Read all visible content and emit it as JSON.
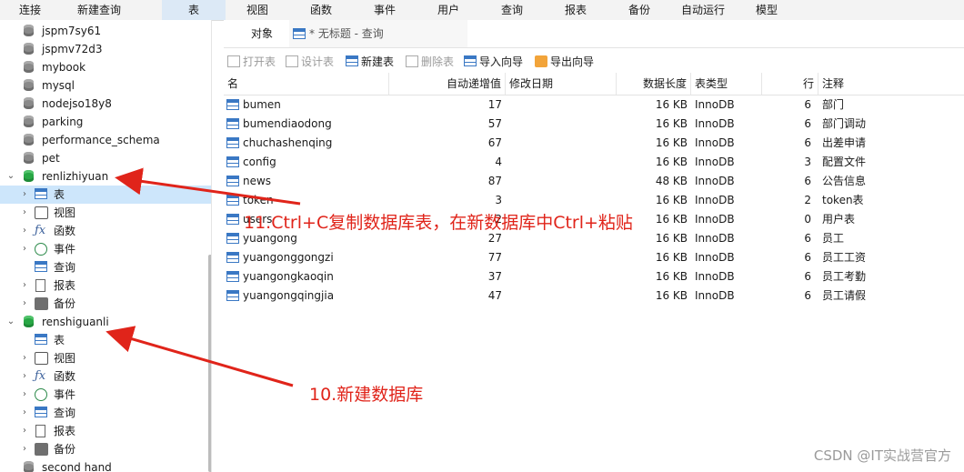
{
  "menubar": {
    "items": [
      "连接",
      "新建查询",
      "表",
      "视图",
      "函数",
      "事件",
      "用户",
      "查询",
      "报表",
      "备份",
      "自动运行",
      "模型"
    ],
    "active_index": 2
  },
  "sidebar": {
    "rows": [
      {
        "label": "jspm7sy61"
      },
      {
        "label": "jspmv72d3"
      },
      {
        "label": "mybook"
      },
      {
        "label": "mysql"
      },
      {
        "label": "nodejso18y8"
      },
      {
        "label": "parking"
      },
      {
        "label": "performance_schema"
      },
      {
        "label": "pet"
      },
      {
        "label": "renlizhiyuan"
      },
      {
        "label": "表"
      },
      {
        "label": "视图"
      },
      {
        "label": "函数"
      },
      {
        "label": "事件"
      },
      {
        "label": "查询"
      },
      {
        "label": "报表"
      },
      {
        "label": "备份"
      },
      {
        "label": "renshiguanli"
      },
      {
        "label": "表"
      },
      {
        "label": "视图"
      },
      {
        "label": "函数"
      },
      {
        "label": "事件"
      },
      {
        "label": "查询"
      },
      {
        "label": "报表"
      },
      {
        "label": "备份"
      },
      {
        "label": "second hand"
      }
    ]
  },
  "tabs": {
    "objects": "对象",
    "query": "* 无标题 - 查询"
  },
  "toolbar": {
    "open": "打开表",
    "design": "设计表",
    "new": "新建表",
    "delete": "删除表",
    "import": "导入向导",
    "export": "导出向导"
  },
  "table": {
    "headers": {
      "name": "名",
      "auto_inc": "自动递增值",
      "modified": "修改日期",
      "data_len": "数据长度",
      "engine": "表类型",
      "rows": "行",
      "comment": "注释"
    },
    "rows": [
      {
        "name": "bumen",
        "auto_inc": "17",
        "modified": "",
        "data_len": "16 KB",
        "engine": "InnoDB",
        "rows": "6",
        "comment": "部门"
      },
      {
        "name": "bumendiaodong",
        "auto_inc": "57",
        "modified": "",
        "data_len": "16 KB",
        "engine": "InnoDB",
        "rows": "6",
        "comment": "部门调动"
      },
      {
        "name": "chuchashenqing",
        "auto_inc": "67",
        "modified": "",
        "data_len": "16 KB",
        "engine": "InnoDB",
        "rows": "6",
        "comment": "出差申请"
      },
      {
        "name": "config",
        "auto_inc": "4",
        "modified": "",
        "data_len": "16 KB",
        "engine": "InnoDB",
        "rows": "3",
        "comment": "配置文件"
      },
      {
        "name": "news",
        "auto_inc": "87",
        "modified": "",
        "data_len": "48 KB",
        "engine": "InnoDB",
        "rows": "6",
        "comment": "公告信息"
      },
      {
        "name": "token",
        "auto_inc": "3",
        "modified": "",
        "data_len": "16 KB",
        "engine": "InnoDB",
        "rows": "2",
        "comment": "token表"
      },
      {
        "name": "users",
        "auto_inc": "2",
        "modified": "",
        "data_len": "16 KB",
        "engine": "InnoDB",
        "rows": "0",
        "comment": "用户表"
      },
      {
        "name": "yuangong",
        "auto_inc": "27",
        "modified": "",
        "data_len": "16 KB",
        "engine": "InnoDB",
        "rows": "6",
        "comment": "员工"
      },
      {
        "name": "yuangonggongzi",
        "auto_inc": "77",
        "modified": "",
        "data_len": "16 KB",
        "engine": "InnoDB",
        "rows": "6",
        "comment": "员工工资"
      },
      {
        "name": "yuangongkaoqin",
        "auto_inc": "37",
        "modified": "",
        "data_len": "16 KB",
        "engine": "InnoDB",
        "rows": "6",
        "comment": "员工考勤"
      },
      {
        "name": "yuangongqingjia",
        "auto_inc": "47",
        "modified": "",
        "data_len": "16 KB",
        "engine": "InnoDB",
        "rows": "6",
        "comment": "员工请假"
      }
    ]
  },
  "annotations": {
    "step11": "11.Ctrl+C复制数据库表，在新数据库中Ctrl+粘贴",
    "step10": "10.新建数据库"
  },
  "watermark": "CSDN @IT实战营官方",
  "colors": {
    "annotation": "#e0241a",
    "selection": "#cde6fb",
    "db_connected": "#28a745"
  }
}
